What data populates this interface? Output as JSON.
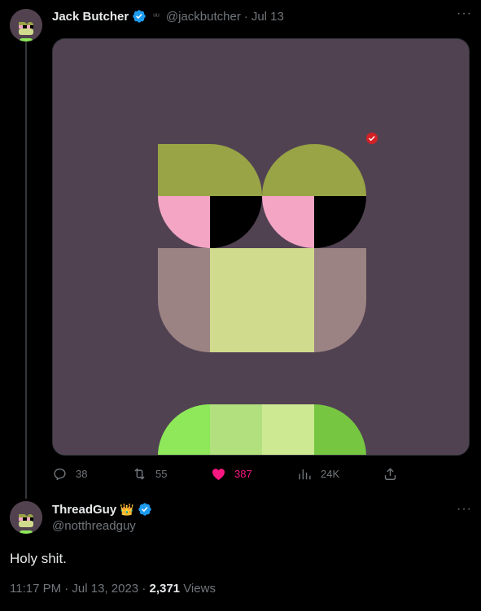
{
  "quoted_tweet": {
    "author_name": "Jack Butcher",
    "handle": "@jackbutcher",
    "date": "Jul 13",
    "emoji": "ᵘᵘ",
    "actions": {
      "replies": "38",
      "retweets": "55",
      "likes": "387",
      "views": "24K"
    }
  },
  "main_tweet": {
    "author_name": "ThreadGuy",
    "badge_emoji": "👑",
    "handle": "@notthreadguy",
    "text": "Holy shit.",
    "time": "11:17 PM · Jul 13, 2023 · ",
    "views_count": "2,371",
    "views_label": " Views"
  },
  "colors": {
    "background": "#000000",
    "verified": "#1d9bf0",
    "like": "#f91880",
    "muted": "#71767b"
  },
  "icons": [
    "verified-badge-icon",
    "more-icon",
    "reply-icon",
    "retweet-icon",
    "heart-icon",
    "analytics-icon",
    "share-icon"
  ]
}
